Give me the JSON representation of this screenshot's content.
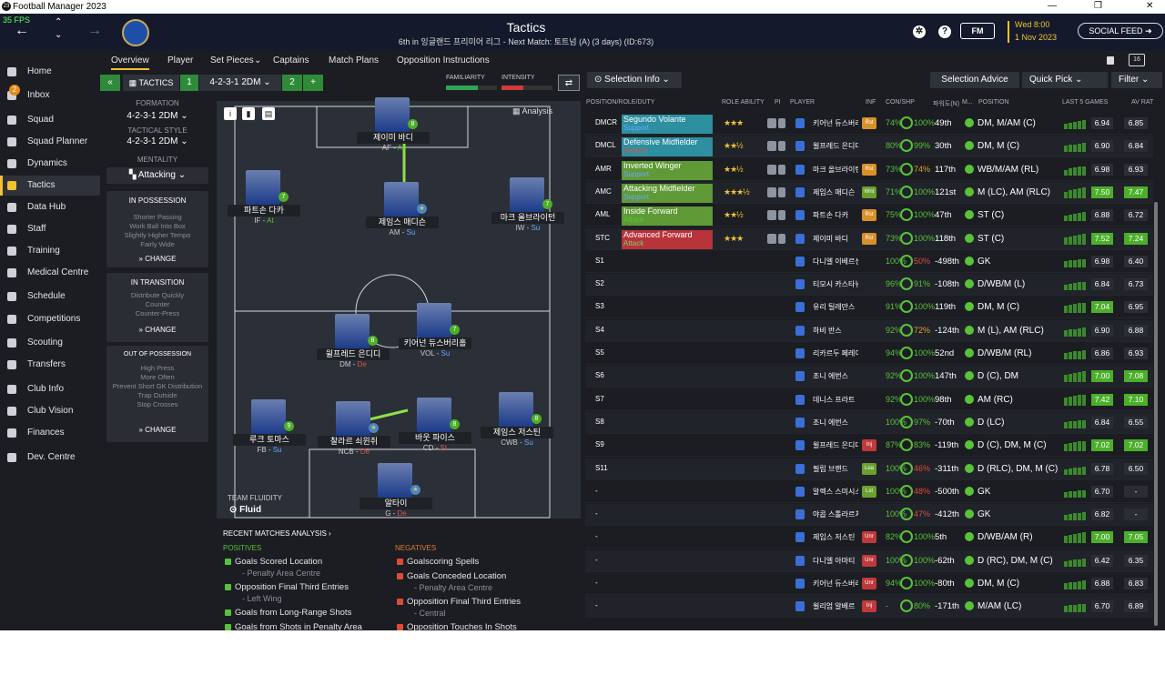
{
  "window": {
    "title": "Football Manager 2023",
    "min": "—",
    "max": "❐",
    "close": "✕"
  },
  "header": {
    "fps": "35 FPS",
    "title": "Tactics",
    "subtitle": "6th in 잉글랜드 프리미어 리그 - Next Match: 토트넘 (A) (3 days) (ID:673)",
    "fm_label": "FM",
    "date_day": "Wed 8:00",
    "date": "1 Nov 2023",
    "social": "SOCIAL FEED"
  },
  "sidebar": {
    "items": [
      {
        "label": "Home",
        "icon": "home-icon"
      },
      {
        "label": "Inbox",
        "icon": "inbox-icon",
        "badge": "2"
      },
      {
        "label": "Squad",
        "icon": "shirt-icon"
      },
      {
        "label": "Squad Planner",
        "icon": "planner-icon"
      },
      {
        "label": "Dynamics",
        "icon": "dynamics-icon"
      },
      {
        "label": "Tactics",
        "icon": "tactics-icon",
        "active": true
      },
      {
        "label": "Data Hub",
        "icon": "data-hub-icon"
      },
      {
        "label": "Staff",
        "icon": "staff-icon"
      },
      {
        "label": "Training",
        "icon": "training-icon"
      },
      {
        "label": "Medical Centre",
        "icon": "medical-icon"
      },
      {
        "label": "Schedule",
        "icon": "calendar-icon"
      },
      {
        "label": "Competitions",
        "icon": "trophy-icon"
      },
      {
        "label": "Scouting",
        "icon": "magnifier-icon"
      },
      {
        "label": "Transfers",
        "icon": "transfers-icon"
      },
      {
        "label": "Club Info",
        "icon": "shield-icon"
      },
      {
        "label": "Club Vision",
        "icon": "vision-icon"
      },
      {
        "label": "Finances",
        "icon": "finances-icon"
      },
      {
        "label": "Dev. Centre",
        "icon": "dev-centre-icon"
      }
    ]
  },
  "subnav": {
    "tabs": [
      "Overview",
      "Player",
      "Set Pieces",
      "Captains",
      "Match Plans",
      "Opposition Instructions"
    ],
    "setpieces_arrow": "⌄"
  },
  "toolbar": {
    "back": "«",
    "tactics": "TACTICS",
    "slot1": "1",
    "formation": "4-2-3-1 2DM",
    "slot2": "2",
    "plus": "+",
    "familiarity": "FAMILIARITY",
    "intensity": "INTENSITY",
    "familiarity_level": 0.62,
    "intensity_level": 0.42
  },
  "tactic_left": {
    "formation_label": "FORMATION",
    "formation_value": "4-2-3-1 2DM",
    "style_label": "TACTICAL STYLE",
    "style_value": "4-2-3-1 2DM",
    "mentality_label": "MENTALITY",
    "mentality_value": "Attacking",
    "in_possession": {
      "title": "IN POSSESSION",
      "items": [
        "Shorter Passing",
        "Work Ball Into Box",
        "Slightly Higher Tempo",
        "Fairly Wide"
      ],
      "change": "CHANGE"
    },
    "in_transition": {
      "title": "IN TRANSITION",
      "items": [
        "Distribute Quickly",
        "Counter",
        "Counter-Press"
      ],
      "change": "CHANGE"
    },
    "out_of_possession": {
      "title": "OUT OF POSSESSION",
      "items": [
        "High Press",
        "More Often",
        "Prevent Short GK Distribution",
        "Trap Outside",
        "Stop Crosses"
      ],
      "change": "CHANGE"
    }
  },
  "pitch": {
    "analysis": "Analysis",
    "fluidity_label": "TEAM FLUIDITY",
    "fluidity_value": "Fluid",
    "players": [
      {
        "name": "제이미 바디",
        "pos": "AF",
        "duty": "At",
        "badge": "8"
      },
      {
        "name": "파트손 다카",
        "pos": "IF",
        "duty": "At",
        "badge": "7"
      },
      {
        "name": "제임스 매디슨",
        "pos": "AM",
        "duty": "Su",
        "badge": "★"
      },
      {
        "name": "마크 올브라이턴",
        "pos": "IW",
        "duty": "Su",
        "badge": "7"
      },
      {
        "name": "윌프레드 은디디",
        "pos": "DM",
        "duty": "De",
        "badge": "8"
      },
      {
        "name": "키어넌 듀스버리홀",
        "pos": "VOL",
        "duty": "Su",
        "badge": "7"
      },
      {
        "name": "루크 토마스",
        "pos": "FB",
        "duty": "Su",
        "badge": "9"
      },
      {
        "name": "찰라르 쇠윈쥐",
        "pos": "NCB",
        "duty": "De",
        "badge": "★"
      },
      {
        "name": "바웃 파이스",
        "pos": "CD",
        "duty": "St",
        "badge": "8"
      },
      {
        "name": "제임스 저스틴",
        "pos": "CWB",
        "duty": "Su",
        "badge": "8"
      },
      {
        "name": "알타이",
        "pos": "G",
        "duty": "De",
        "badge": "★"
      }
    ]
  },
  "recent": {
    "title": "RECENT MATCHES ANALYSIS",
    "positives_label": "POSITIVES",
    "negatives_label": "NEGATIVES",
    "positives": [
      {
        "text": "Goals Scored Location",
        "sub": "- Penalty Area Centre"
      },
      {
        "text": "Opposition Final Third Entries",
        "sub": "- Left Wing"
      },
      {
        "text": "Goals from Long-Range Shots",
        "sub": ""
      },
      {
        "text": "Goals from Shots in Penalty Area",
        "sub": ""
      }
    ],
    "negatives": [
      {
        "text": "Goalscoring Spells",
        "sub": ""
      },
      {
        "text": "Goals Conceded Location",
        "sub": "- Penalty Area Centre"
      },
      {
        "text": "Opposition Final Third Entries",
        "sub": "- Central"
      },
      {
        "text": "Opposition Touches In Shots",
        "sub": ""
      }
    ]
  },
  "right_panel": {
    "selection_info": "Selection Info",
    "selection_advice": "Selection Advice",
    "quick_pick": "Quick Pick",
    "filter": "Filter",
    "headers": [
      "POSITION/ROLE/DUTY",
      "ROLE ABILITY",
      "PI",
      "PLAYER",
      "INF",
      "CON/SHP",
      "파워도(N)",
      "M...",
      "POSITION",
      "LAST 5 GAMES",
      "AV RAT"
    ],
    "rows": [
      {
        "pos": "DMCR",
        "role": "Segundo Volante",
        "duty": "Support",
        "bg": "#2d8fa0",
        "stars": "★★★",
        "name": "키어넌 듀스버리홀",
        "inf": "Rst",
        "inf_c": "#d9902a",
        "con": "74%",
        "shp": "100%",
        "shp_c": "",
        "rank": "49th",
        "position": "DM, M/AM (C)",
        "l5": [
          4,
          5,
          6,
          7,
          8
        ],
        "av1": "6.94",
        "av1g": false,
        "av2": "6.85",
        "av2g": false
      },
      {
        "pos": "DMCL",
        "role": "Defensive Midfielder",
        "duty": "Defend",
        "bg": "#2d8fa0",
        "stars": "★★½",
        "name": "윌프레드 은디디",
        "inf": "",
        "inf_c": "",
        "con": "80%",
        "shp": "99%",
        "shp_c": "",
        "rank": "30th",
        "position": "DM, M (C)",
        "l5": [
          5,
          6,
          6,
          7,
          8
        ],
        "av1": "6.90",
        "av1g": false,
        "av2": "6.84",
        "av2g": false
      },
      {
        "pos": "AMR",
        "role": "Inverted Winger",
        "duty": "Support",
        "bg": "#5f9a36",
        "stars": "★★½",
        "name": "마크 올브라이턴",
        "inf": "Rst",
        "inf_c": "#d9902a",
        "con": "73%",
        "shp": "74%",
        "shp_c": "o",
        "rank": "117th",
        "position": "WB/M/AM (RL)",
        "l5": [
          4,
          6,
          7,
          8,
          8
        ],
        "av1": "6.98",
        "av1g": false,
        "av2": "6.93",
        "av2g": false
      },
      {
        "pos": "AMC",
        "role": "Attacking Midfielder",
        "duty": "Support",
        "bg": "#5f9a36",
        "stars": "★★★½",
        "name": "제임스 매디슨",
        "inf": "Wnt",
        "inf_c": "#6aa030",
        "con": "71%",
        "shp": "100%",
        "shp_c": "",
        "rank": "121st",
        "position": "M (LC), AM (RLC)",
        "l5": [
          5,
          7,
          8,
          9,
          10
        ],
        "av1": "7.50",
        "av1g": true,
        "av2": "7.47",
        "av2g": true
      },
      {
        "pos": "AML",
        "role": "Inside Forward",
        "duty": "Attack",
        "bg": "#5f9a36",
        "stars": "★★½",
        "name": "파트손 다카",
        "inf": "Rst",
        "inf_c": "#d9902a",
        "con": "75%",
        "shp": "100%",
        "shp_c": "",
        "rank": "47th",
        "position": "ST (C)",
        "l5": [
          4,
          5,
          6,
          7,
          8
        ],
        "av1": "6.88",
        "av1g": false,
        "av2": "6.72",
        "av2g": false
      },
      {
        "pos": "STC",
        "role": "Advanced Forward",
        "duty": "Attack",
        "bg": "#b8333a",
        "stars": "★★★",
        "name": "제이미 바디",
        "inf": "Rst",
        "inf_c": "#d9902a",
        "con": "73%",
        "shp": "100%",
        "shp_c": "",
        "rank": "118th",
        "position": "ST (C)",
        "l5": [
          6,
          7,
          8,
          9,
          10
        ],
        "av1": "7.52",
        "av1g": true,
        "av2": "7.24",
        "av2g": true
      },
      {
        "pos": "S1",
        "role": "",
        "duty": "",
        "bg": "",
        "stars": "",
        "name": "다니엘 이베르센",
        "inf": "",
        "inf_c": "",
        "con": "100%",
        "shp": "50%",
        "shp_c": "r",
        "rank": "-498th",
        "position": "GK",
        "l5": [
          5,
          6,
          6,
          7,
          7
        ],
        "av1": "6.98",
        "av1g": false,
        "av2": "6.40",
        "av2g": false
      },
      {
        "pos": "S2",
        "role": "",
        "duty": "",
        "bg": "",
        "stars": "",
        "name": "티모시 카스타뉴",
        "inf": "",
        "inf_c": "",
        "con": "96%",
        "shp": "91%",
        "shp_c": "",
        "rank": "-108th",
        "position": "D/WB/M (L)",
        "l5": [
          4,
          5,
          6,
          7,
          7
        ],
        "av1": "6.84",
        "av1g": false,
        "av2": "6.73",
        "av2g": false
      },
      {
        "pos": "S3",
        "role": "",
        "duty": "",
        "bg": "",
        "stars": "",
        "name": "유리 틸레만스",
        "inf": "",
        "inf_c": "",
        "con": "91%",
        "shp": "100%",
        "shp_c": "",
        "rank": "119th",
        "position": "DM, M (C)",
        "l5": [
          6,
          7,
          8,
          9,
          9
        ],
        "av1": "7.04",
        "av1g": true,
        "av2": "6.95",
        "av2g": false
      },
      {
        "pos": "S4",
        "role": "",
        "duty": "",
        "bg": "",
        "stars": "",
        "name": "하비 반스",
        "inf": "",
        "inf_c": "",
        "con": "92%",
        "shp": "72%",
        "shp_c": "o",
        "rank": "-124th",
        "position": "M (L), AM (RLC)",
        "l5": [
          5,
          6,
          6,
          7,
          8
        ],
        "av1": "6.90",
        "av1g": false,
        "av2": "6.88",
        "av2g": false
      },
      {
        "pos": "S5",
        "role": "",
        "duty": "",
        "bg": "",
        "stars": "",
        "name": "리카르두 페레이라",
        "inf": "",
        "inf_c": "",
        "con": "94%",
        "shp": "100%",
        "shp_c": "",
        "rank": "52nd",
        "position": "D/WB/M (RL)",
        "l5": [
          5,
          6,
          7,
          7,
          8
        ],
        "av1": "6.86",
        "av1g": false,
        "av2": "6.93",
        "av2g": false
      },
      {
        "pos": "S6",
        "role": "",
        "duty": "",
        "bg": "",
        "stars": "",
        "name": "조니 에번스",
        "inf": "",
        "inf_c": "",
        "con": "92%",
        "shp": "100%",
        "shp_c": "",
        "rank": "147th",
        "position": "D (C), DM",
        "l5": [
          6,
          7,
          8,
          9,
          10
        ],
        "av1": "7.00",
        "av1g": true,
        "av2": "7.08",
        "av2g": true
      },
      {
        "pos": "S7",
        "role": "",
        "duty": "",
        "bg": "",
        "stars": "",
        "name": "데니스 프라트",
        "inf": "",
        "inf_c": "",
        "con": "92%",
        "shp": "100%",
        "shp_c": "",
        "rank": "98th",
        "position": "AM (RC)",
        "l5": [
          7,
          8,
          9,
          10,
          10
        ],
        "av1": "7.42",
        "av1g": true,
        "av2": "7.10",
        "av2g": true
      },
      {
        "pos": "S8",
        "role": "",
        "duty": "",
        "bg": "",
        "stars": "",
        "name": "조니 에번스",
        "inf": "",
        "inf_c": "",
        "con": "100%",
        "shp": "97%",
        "shp_c": "",
        "rank": "-70th",
        "position": "D (LC)",
        "l5": [
          5,
          6,
          6,
          7,
          7
        ],
        "av1": "6.84",
        "av1g": false,
        "av2": "6.55",
        "av2g": false
      },
      {
        "pos": "S9",
        "role": "",
        "duty": "",
        "bg": "",
        "stars": "",
        "name": "윌프레드 은디디",
        "inf": "Inj",
        "inf_c": "#c0393a",
        "con": "87%",
        "shp": "83%",
        "shp_c": "",
        "rank": "-119th",
        "position": "D (C), DM, M (C)",
        "l5": [
          6,
          7,
          8,
          9,
          9
        ],
        "av1": "7.02",
        "av1g": true,
        "av2": "7.02",
        "av2g": true
      },
      {
        "pos": "S11",
        "role": "",
        "duty": "",
        "bg": "",
        "stars": "",
        "name": "필립 브랜드",
        "inf": "Loa",
        "inf_c": "#6aa030",
        "con": "100%",
        "shp": "46%",
        "shp_c": "r",
        "rank": "-311th",
        "position": "D (RLC), DM, M (C)",
        "l5": [
          4,
          5,
          6,
          6,
          7
        ],
        "av1": "6.78",
        "av1g": false,
        "av2": "6.50",
        "av2g": false
      },
      {
        "pos": "-",
        "role": "",
        "duty": "",
        "bg": "",
        "stars": "",
        "name": "알렉스 스미시스",
        "inf": "Lst",
        "inf_c": "#6aa030",
        "con": "100%",
        "shp": "48%",
        "shp_c": "r",
        "rank": "-500th",
        "position": "GK",
        "l5": [
          4,
          5,
          5,
          6,
          6
        ],
        "av1": "6.70",
        "av1g": false,
        "av2": "-",
        "av2g": false
      },
      {
        "pos": "-",
        "role": "",
        "duty": "",
        "bg": "",
        "stars": "",
        "name": "야콥 스톨라르치크",
        "inf": "",
        "inf_c": "",
        "con": "100%",
        "shp": "47%",
        "shp_c": "r",
        "rank": "-412th",
        "position": "GK",
        "l5": [
          4,
          5,
          6,
          6,
          7
        ],
        "av1": "6.82",
        "av1g": false,
        "av2": "-",
        "av2g": false
      },
      {
        "pos": "-",
        "role": "",
        "duty": "",
        "bg": "",
        "stars": "",
        "name": "제임스 저스틴",
        "inf": "Unr",
        "inf_c": "#c0393a",
        "con": "82%",
        "shp": "100%",
        "shp_c": "",
        "rank": "5th",
        "position": "D/WB/AM (R)",
        "l5": [
          6,
          7,
          8,
          9,
          10
        ],
        "av1": "7.00",
        "av1g": true,
        "av2": "7.05",
        "av2g": true
      },
      {
        "pos": "-",
        "role": "",
        "duty": "",
        "bg": "",
        "stars": "",
        "name": "다니엘 아마티",
        "inf": "Unr",
        "inf_c": "#c0393a",
        "con": "100%",
        "shp": "100%",
        "shp_c": "",
        "rank": "-62th",
        "position": "D (RC), DM, M (C)",
        "l5": [
          4,
          5,
          6,
          6,
          7
        ],
        "av1": "6.42",
        "av1g": false,
        "av2": "6.35",
        "av2g": false
      },
      {
        "pos": "-",
        "role": "",
        "duty": "",
        "bg": "",
        "stars": "",
        "name": "키어넌 듀스버리홀",
        "inf": "Unr",
        "inf_c": "#c0393a",
        "con": "94%",
        "shp": "100%",
        "shp_c": "",
        "rank": "-80th",
        "position": "DM, M (C)",
        "l5": [
          5,
          6,
          6,
          7,
          8
        ],
        "av1": "6.88",
        "av1g": false,
        "av2": "6.83",
        "av2g": false
      },
      {
        "pos": "-",
        "role": "",
        "duty": "",
        "bg": "",
        "stars": "",
        "name": "윌리엄 알베르",
        "inf": "Inj",
        "inf_c": "#c0393a",
        "con": "-",
        "shp": "80%",
        "shp_c": "",
        "rank": "-171th",
        "position": "M/AM (LC)",
        "l5": [
          5,
          6,
          6,
          7,
          7
        ],
        "av1": "6.70",
        "av1g": false,
        "av2": "6.89",
        "av2g": false
      }
    ]
  }
}
